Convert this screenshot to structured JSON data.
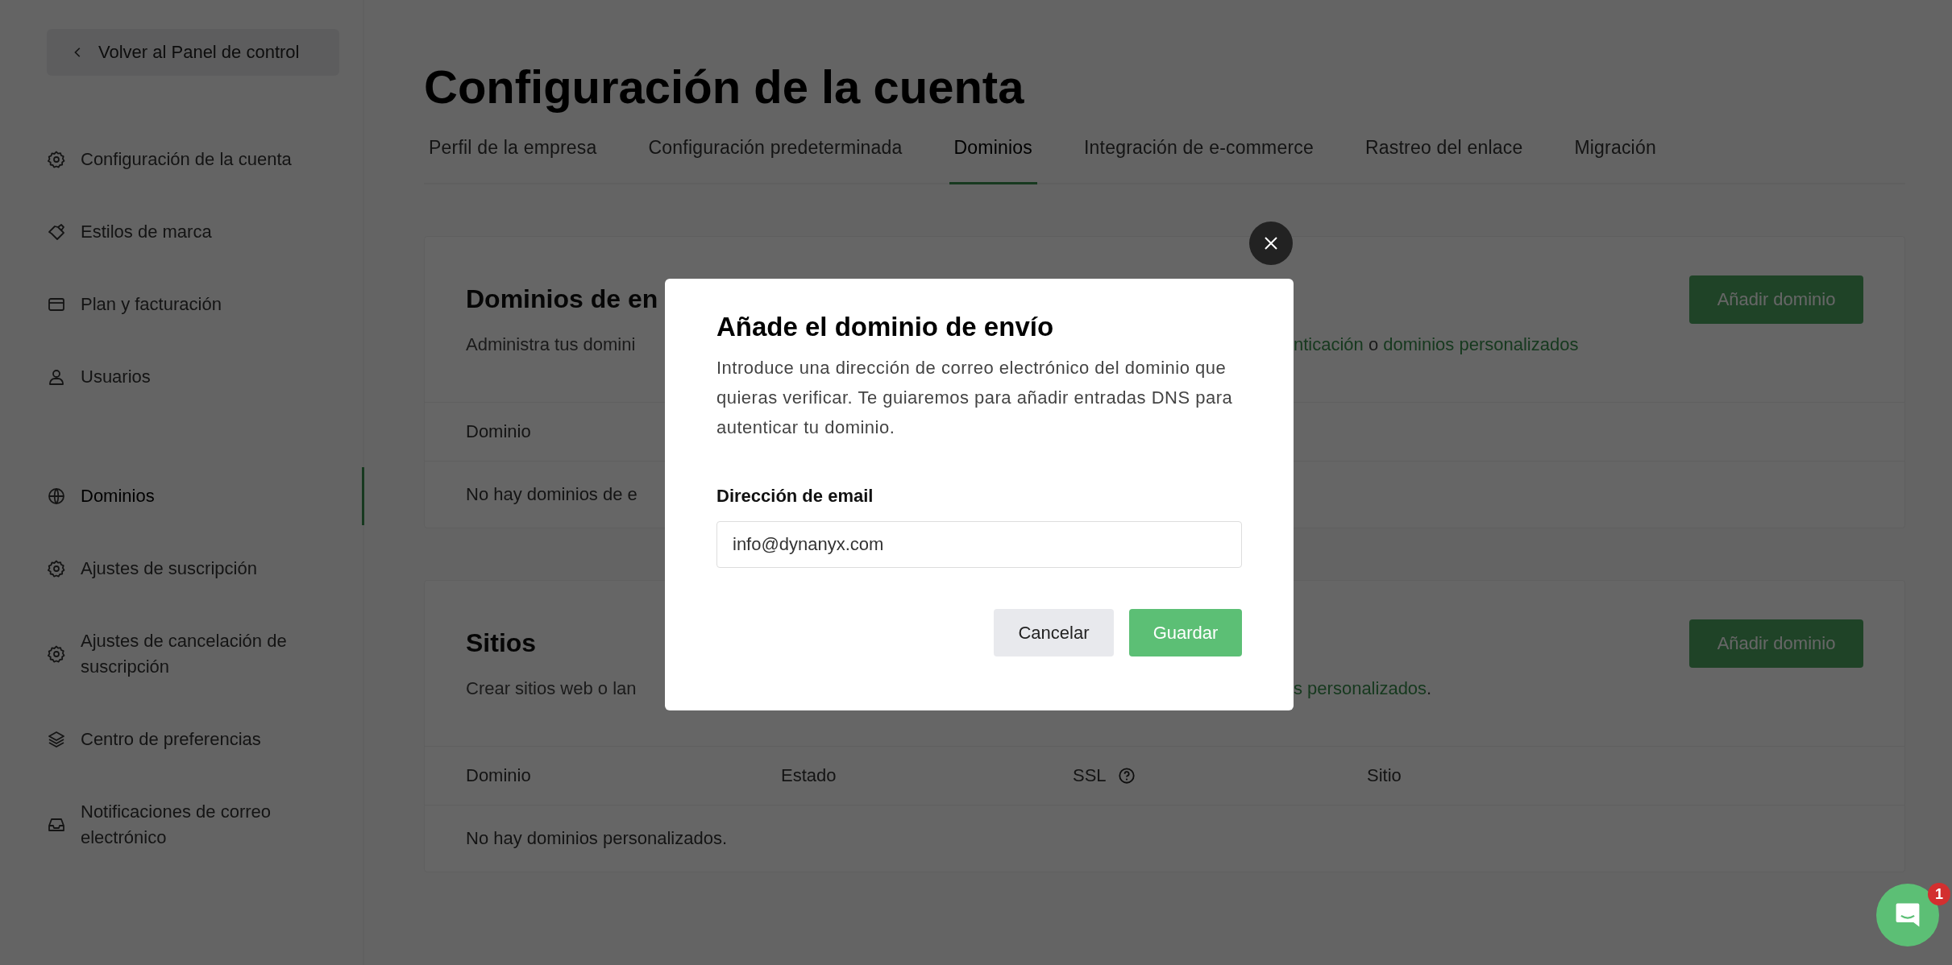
{
  "back_button": {
    "label": "Volver al Panel de control"
  },
  "sidebar": {
    "groups": [
      {
        "items": [
          {
            "label": "Configuración de la cuenta",
            "selected": false
          },
          {
            "label": "Estilos de marca",
            "selected": false
          },
          {
            "label": "Plan y facturación",
            "selected": false
          },
          {
            "label": "Usuarios",
            "selected": false
          }
        ]
      },
      {
        "items": [
          {
            "label": "Dominios",
            "selected": true
          },
          {
            "label": "Ajustes de suscripción",
            "selected": false
          },
          {
            "label": "Ajustes de cancelación de suscripción",
            "selected": false
          },
          {
            "label": "Centro de preferencias",
            "selected": false
          },
          {
            "label": "Notificaciones de correo electrónico",
            "selected": false
          }
        ]
      }
    ]
  },
  "page_title": "Configuración de la cuenta",
  "tabs": [
    {
      "label": "Perfil de la empresa",
      "selected": false
    },
    {
      "label": "Configuración predeterminada",
      "selected": false
    },
    {
      "label": "Dominios",
      "selected": true
    },
    {
      "label": "Integración de e-commerce",
      "selected": false
    },
    {
      "label": "Rastreo del enlace",
      "selected": false
    },
    {
      "label": "Migración",
      "selected": false
    }
  ],
  "cards": [
    {
      "title": "Dominios de en",
      "description_left": "Administra tus domini",
      "description_right": [
        {
          "kind": "link",
          "text": "nticación"
        },
        {
          "kind": "text",
          "text": " o "
        },
        {
          "kind": "link",
          "text": "dominios personalizados"
        }
      ],
      "button": "Añadir dominio",
      "columns": [
        {
          "label": "Dominio",
          "help": false
        }
      ],
      "empty": "No hay dominios de e"
    },
    {
      "title": "Sitios",
      "description_left": "Crear sitios web o lan",
      "description_right": [
        {
          "kind": "link",
          "text": "s personalizados"
        },
        {
          "kind": "text",
          "text": "."
        }
      ],
      "button": "Añadir dominio",
      "columns": [
        {
          "label": "Dominio",
          "help": false
        },
        {
          "label": "Estado",
          "help": false
        },
        {
          "label": "SSL",
          "help": true
        },
        {
          "label": "Sitio",
          "help": false
        }
      ],
      "empty": "No hay dominios personalizados."
    }
  ],
  "modal": {
    "title": "Añade el dominio de envío",
    "text": "Introduce una dirección de correo electrónico del dominio que quieras verificar. Te guiaremos para añadir entradas DNS para autenticar tu dominio.",
    "field_label": "Dirección de email",
    "field_value": "info@dynanyx.com",
    "buttons": [
      {
        "label": "Cancelar",
        "kind": "secondary"
      },
      {
        "label": "Guardar",
        "kind": "primary"
      }
    ]
  },
  "chat": {
    "badge": "1"
  }
}
